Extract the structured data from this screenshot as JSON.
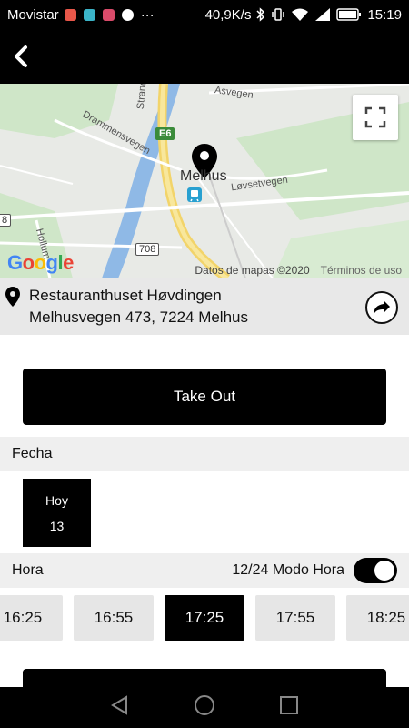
{
  "status_bar": {
    "carrier": "Movistar",
    "more": "···",
    "speed": "40,9K/s",
    "time": "15:19"
  },
  "map": {
    "place": "Melhus",
    "labels": {
      "asvegen": "Asvegen",
      "drammensvegen": "Drammensvegen",
      "lovsetvegen": "Løvsetvegen",
      "hollum": "Hollum",
      "strand": "Strand",
      "road_708": "708",
      "road_e6": "E6",
      "road_8": "8"
    },
    "attribution": "Datos de mapas ©2020",
    "terms": "Términos de uso",
    "google": [
      "G",
      "o",
      "o",
      "g",
      "l",
      "e"
    ]
  },
  "restaurant": {
    "name": "Restauranthuset Høvdingen",
    "address": "Melhusvegen 473, 7224 Melhus"
  },
  "order_type": "Take Out",
  "date_section": {
    "label": "Fecha",
    "day_label": "Hoy",
    "day_number": "13"
  },
  "time_section": {
    "label": "Hora",
    "mode_label": "12/24 Modo Hora",
    "slots": [
      "16:25",
      "16:55",
      "17:25",
      "17:55",
      "18:25"
    ],
    "selected": "17:25"
  },
  "colors": {
    "accent": "#000000",
    "google_blue": "#4285F4",
    "google_red": "#EA4335",
    "google_yellow": "#FBBC05",
    "google_green": "#34A853"
  }
}
